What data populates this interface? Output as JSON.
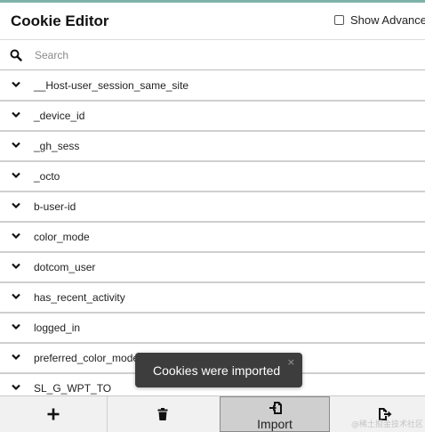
{
  "header": {
    "title": "Cookie Editor",
    "show_advanced_label": "Show Advanced",
    "show_advanced_checked": false
  },
  "search": {
    "placeholder": "Search",
    "value": "",
    "icon": "search-icon"
  },
  "cookies": [
    {
      "name": "__Host-user_session_same_site"
    },
    {
      "name": "_device_id"
    },
    {
      "name": "_gh_sess"
    },
    {
      "name": "_octo"
    },
    {
      "name": "b-user-id"
    },
    {
      "name": "color_mode"
    },
    {
      "name": "dotcom_user"
    },
    {
      "name": "has_recent_activity"
    },
    {
      "name": "logged_in"
    },
    {
      "name": "preferred_color_mode"
    },
    {
      "name": "SL_G_WPT_TO"
    }
  ],
  "toast": {
    "message": "Cookies were imported",
    "close_icon": "×"
  },
  "toolbar": {
    "add_icon": "plus-icon",
    "delete_icon": "trash-icon",
    "import_label": "Import",
    "import_icon": "import-icon",
    "export_icon": "export-icon"
  },
  "watermark": "@稀土掘金技术社区",
  "colors": {
    "accent_line": "#7fb3a8",
    "toast_bg": "#3d3d3d",
    "toolbar_bg": "#f1f1f1",
    "import_active_bg": "#cfcfcf"
  }
}
